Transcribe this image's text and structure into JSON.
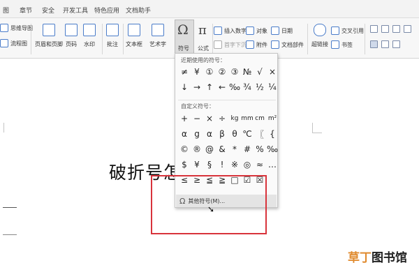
{
  "menu": {
    "items": [
      "图",
      "章节",
      "安全",
      "开发工具",
      "特色应用",
      "文档助手"
    ]
  },
  "ribbon": {
    "left_items": [
      "思维导图",
      "流程图"
    ],
    "header_footer": "页眉和页脚",
    "page_number": "页码",
    "watermark": "水印",
    "comment": "批注",
    "textbox": "文本框",
    "wordart": "艺术字",
    "symbol": "符号",
    "formula": "公式",
    "insert_number": "插入数字",
    "object": "对象",
    "date": "日期",
    "first_drop_cap": "首字下沉",
    "attachment": "附件",
    "doc_parts": "文档部件",
    "hyperlink": "超链接",
    "bookmark": "书签",
    "cross_ref": "交叉引用"
  },
  "document": {
    "text": "破折号怎"
  },
  "symbol_menu": {
    "recent_title": "近期使用的符号：",
    "recent_symbols": [
      [
        "≠",
        "¥",
        "①",
        "②",
        "③",
        "№",
        "√",
        "×"
      ],
      [
        "↓",
        "→",
        "↑",
        "←",
        "‰",
        "¾",
        "½",
        "¼"
      ]
    ],
    "custom_title": "自定义符号：",
    "custom_symbols": [
      [
        "+",
        "−",
        "×",
        "÷",
        "kg",
        "mm",
        "cm",
        "m²"
      ],
      [
        "α",
        "g",
        "α",
        "β",
        "θ",
        "℃",
        "〖",
        "{"
      ],
      [
        "©",
        "®",
        "@",
        "&",
        "*",
        "#",
        "%",
        "‰"
      ],
      [
        "$",
        "¥",
        "§",
        "!",
        "※",
        "◎",
        "≈",
        "…"
      ],
      [
        "≤",
        "≥",
        "≦",
        "≧",
        "□",
        "☑",
        "☒",
        ""
      ]
    ],
    "other_label": "其他符号(M)..."
  },
  "watermark_text": {
    "part1": "草丁",
    "part2": "图书馆"
  },
  "colors": {
    "highlight_box": "#d8333b",
    "watermark_orange": "#e08b2f",
    "accent_blue": "#4a7cc9"
  }
}
